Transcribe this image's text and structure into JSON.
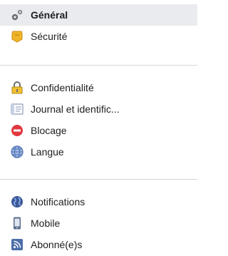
{
  "sections": [
    {
      "items": [
        {
          "label": "Général",
          "icon": "gears-icon",
          "active": true
        },
        {
          "label": "Sécurité",
          "icon": "security-badge-icon",
          "active": false
        }
      ]
    },
    {
      "items": [
        {
          "label": "Confidentialité",
          "icon": "padlock-icon",
          "active": false
        },
        {
          "label": "Journal et identific...",
          "icon": "timeline-icon",
          "active": false
        },
        {
          "label": "Blocage",
          "icon": "block-icon",
          "active": false
        },
        {
          "label": "Langue",
          "icon": "globe-icon",
          "active": false
        }
      ]
    },
    {
      "items": [
        {
          "label": "Notifications",
          "icon": "earth-icon",
          "active": false
        },
        {
          "label": "Mobile",
          "icon": "mobile-phone-icon",
          "active": false
        },
        {
          "label": "Abonné(e)s",
          "icon": "rss-icon",
          "active": false
        }
      ]
    }
  ],
  "colors": {
    "active_background": "#e9ebee",
    "divider": "#d6d6d6",
    "text": "#1c1e21"
  }
}
